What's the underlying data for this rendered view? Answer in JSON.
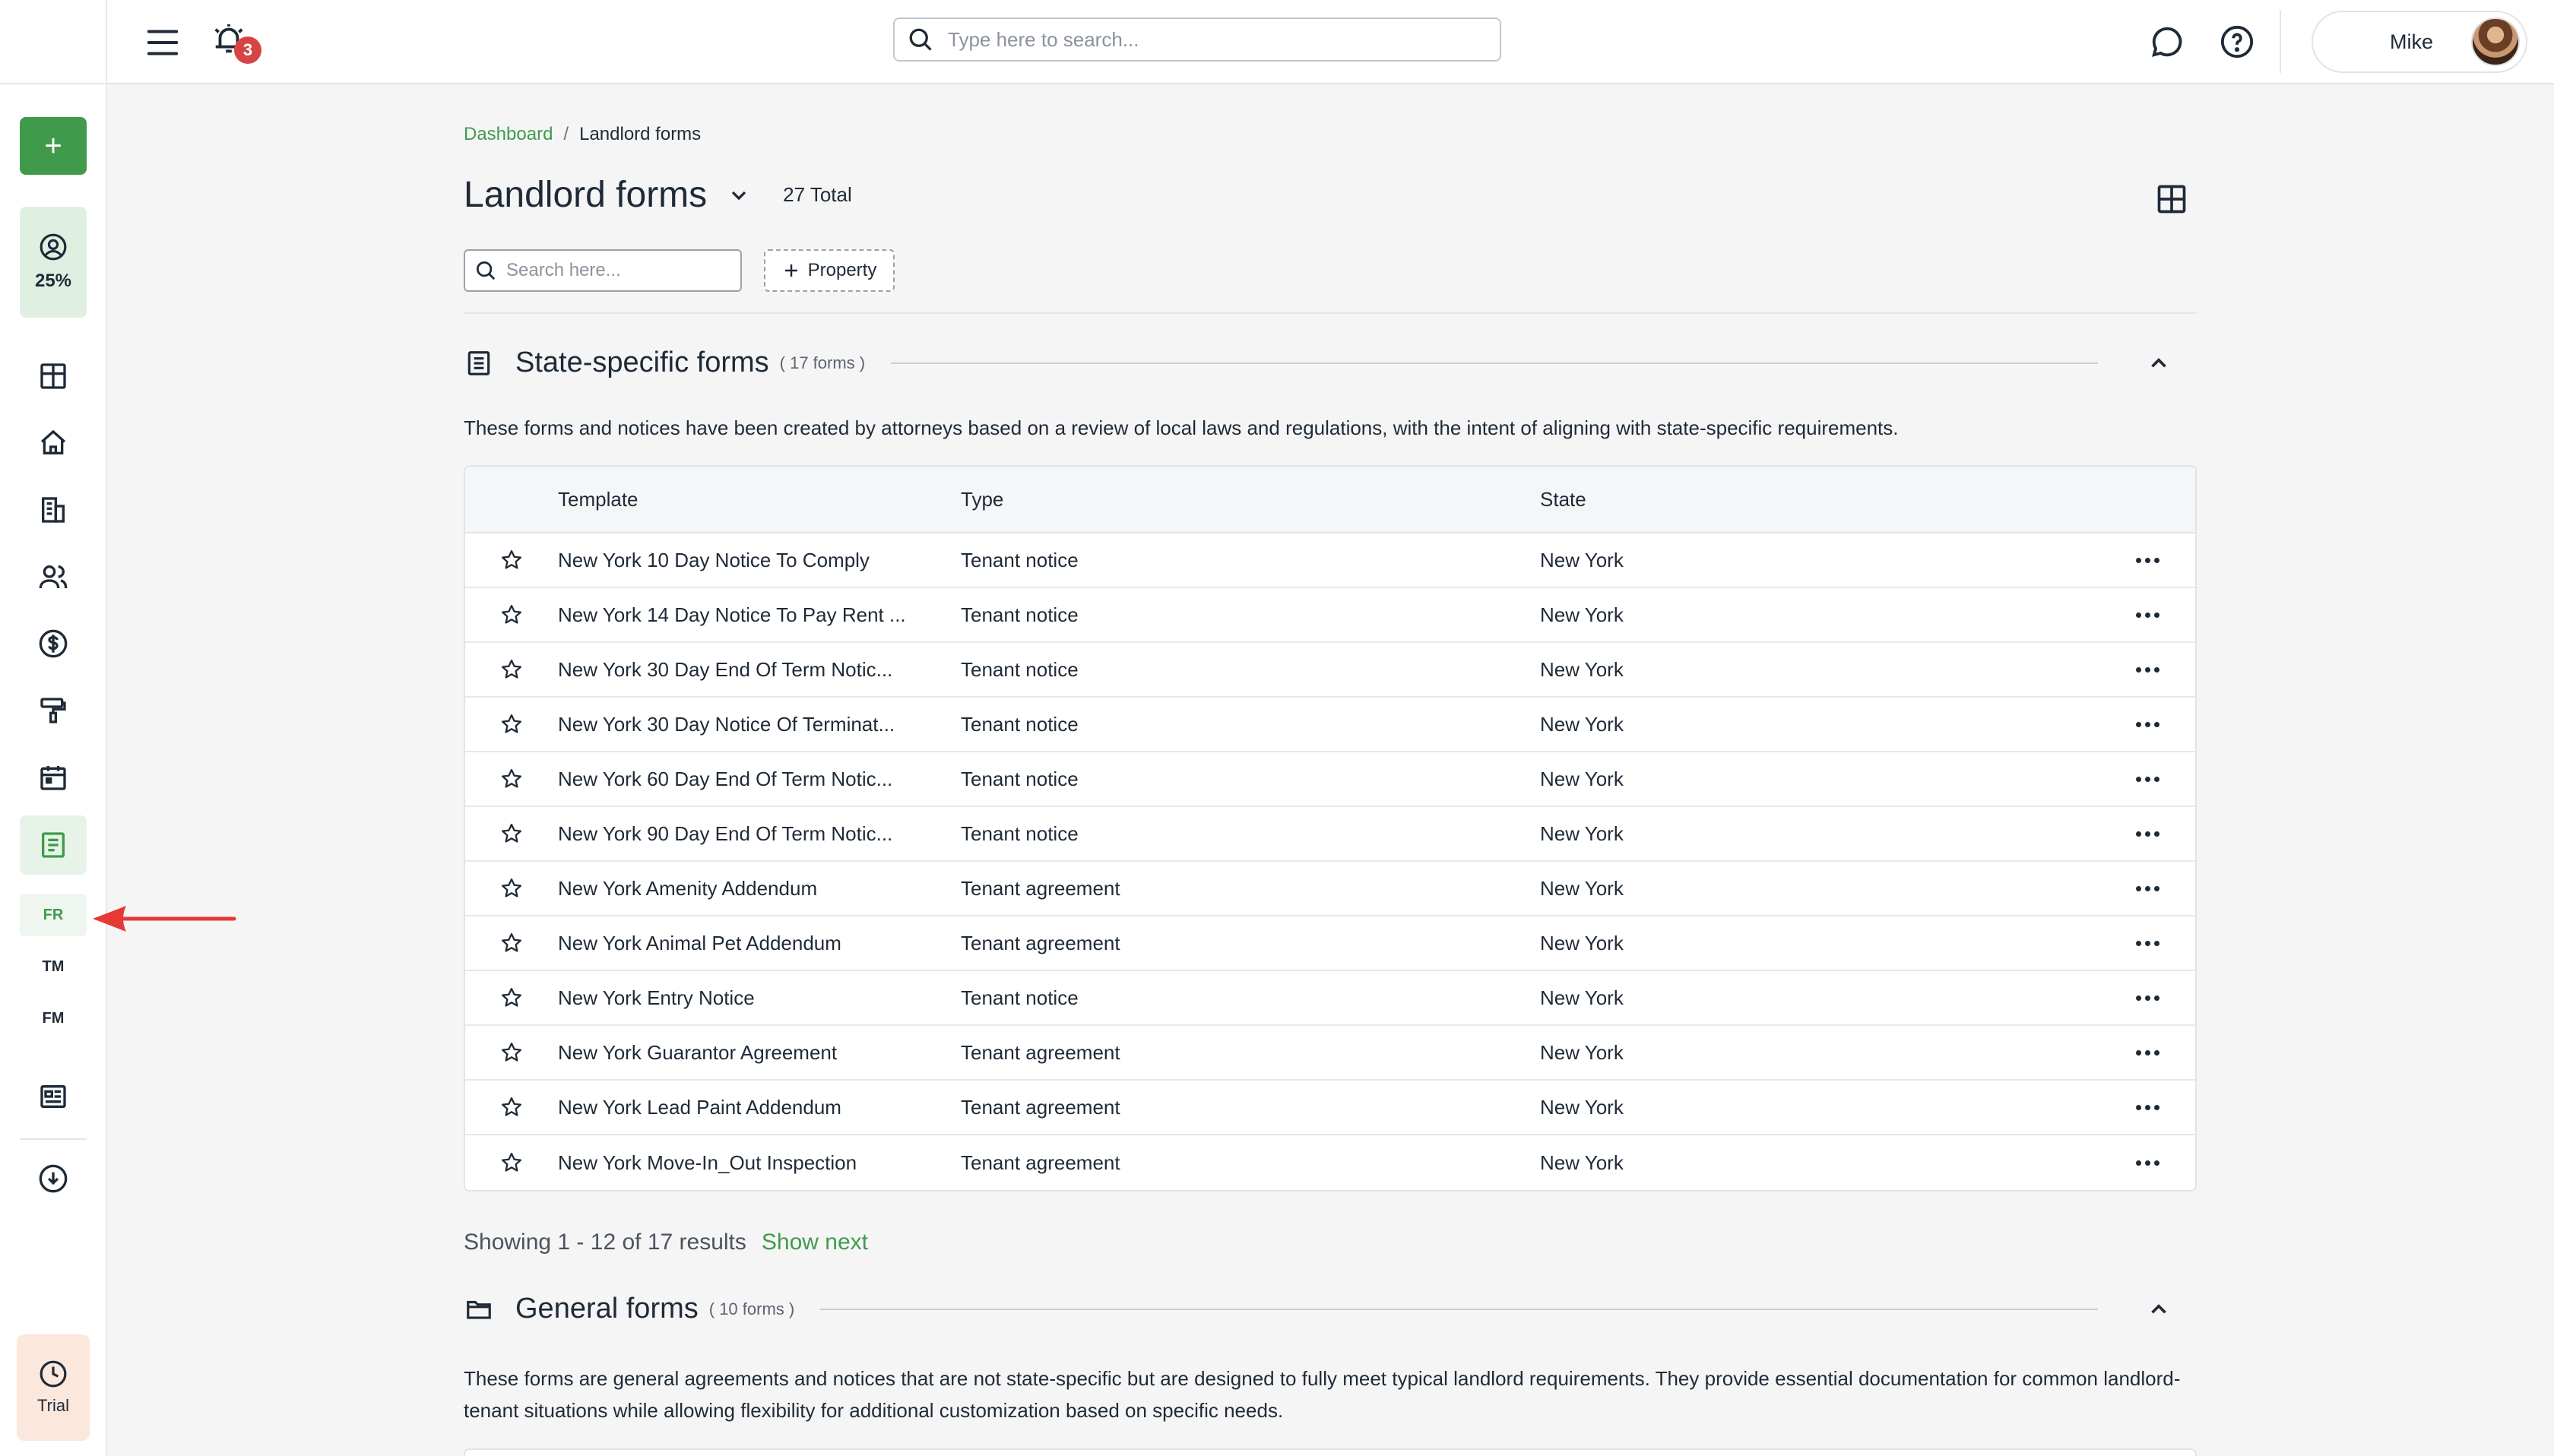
{
  "topbar": {
    "notification_count": "3",
    "search_placeholder": "Type here to search...",
    "user_name": "Mike"
  },
  "sidebar": {
    "add_label": "+",
    "progress_label": "25%",
    "sub_items": [
      {
        "label": "FR",
        "active": true
      },
      {
        "label": "TM",
        "active": false
      },
      {
        "label": "FM",
        "active": false
      }
    ],
    "trial_label": "Trial"
  },
  "breadcrumb": {
    "home": "Dashboard",
    "separator": "/",
    "current": "Landlord forms"
  },
  "page": {
    "title": "Landlord forms",
    "total": "27 Total",
    "search_placeholder": "Search here...",
    "property_button": "Property"
  },
  "sections": {
    "state": {
      "title": "State-specific forms",
      "count": "( 17 forms )",
      "description": "These forms and notices have been created by attorneys based on a review of local laws and regulations, with the intent of aligning with state-specific requirements."
    },
    "general": {
      "title": "General forms",
      "count": "( 10 forms )",
      "description": "These forms are general agreements and notices that are not state-specific but are designed to fully meet typical landlord requirements. They provide essential documentation for common landlord-tenant situations while allowing flexibility for additional customization based on specific needs."
    }
  },
  "table": {
    "columns": [
      "Template",
      "Type",
      "State"
    ],
    "rows": [
      {
        "template": "New York 10 Day Notice To Comply",
        "type": "Tenant notice",
        "state": "New York"
      },
      {
        "template": "New York 14 Day Notice To Pay Rent ...",
        "type": "Tenant notice",
        "state": "New York"
      },
      {
        "template": "New York 30 Day End Of Term Notic...",
        "type": "Tenant notice",
        "state": "New York"
      },
      {
        "template": "New York 30 Day Notice Of Terminat...",
        "type": "Tenant notice",
        "state": "New York"
      },
      {
        "template": "New York 60 Day End Of Term Notic...",
        "type": "Tenant notice",
        "state": "New York"
      },
      {
        "template": "New York 90 Day End Of Term Notic...",
        "type": "Tenant notice",
        "state": "New York"
      },
      {
        "template": "New York Amenity Addendum",
        "type": "Tenant agreement",
        "state": "New York"
      },
      {
        "template": "New York Animal Pet Addendum",
        "type": "Tenant agreement",
        "state": "New York"
      },
      {
        "template": "New York Entry Notice",
        "type": "Tenant notice",
        "state": "New York"
      },
      {
        "template": "New York Guarantor Agreement",
        "type": "Tenant agreement",
        "state": "New York"
      },
      {
        "template": "New York Lead Paint Addendum",
        "type": "Tenant agreement",
        "state": "New York"
      },
      {
        "template": "New York Move-In_Out Inspection",
        "type": "Tenant agreement",
        "state": "New York"
      }
    ]
  },
  "pagination": {
    "showing": "Showing 1 - 12 of 17 results",
    "next": "Show next"
  },
  "colors": {
    "brand_green": "#3f9b4b",
    "badge_red": "#d64545",
    "annotation_red": "#e53935"
  }
}
